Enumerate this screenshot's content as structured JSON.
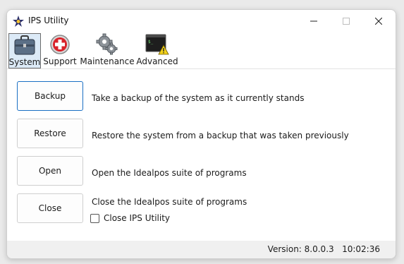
{
  "window": {
    "title": "IPS Utility",
    "icon": "star-gear-icon"
  },
  "toolbar": {
    "items": [
      {
        "label": "System",
        "icon": "briefcase-icon",
        "selected": true
      },
      {
        "label": "Support",
        "icon": "first-aid-icon",
        "selected": false
      },
      {
        "label": "Maintenance",
        "icon": "gears-icon",
        "selected": false
      },
      {
        "label": "Advanced",
        "icon": "terminal-warning-icon",
        "selected": false
      }
    ]
  },
  "actions": [
    {
      "button": "Backup",
      "description": "Take a backup of the system as it currently stands"
    },
    {
      "button": "Restore",
      "description": "Restore the system from a backup that was taken previously"
    },
    {
      "button": "Open",
      "description": "Open the Idealpos suite of programs"
    },
    {
      "button": "Close",
      "description": "Close the Idealpos suite of programs"
    }
  ],
  "close_option": {
    "label": "Close IPS Utility",
    "checked": false
  },
  "status": {
    "version": "Version: 8.0.0.3",
    "time": "10:02:36"
  },
  "colors": {
    "accent": "#1a6fc4",
    "selected_bg": "#dceaf7"
  }
}
